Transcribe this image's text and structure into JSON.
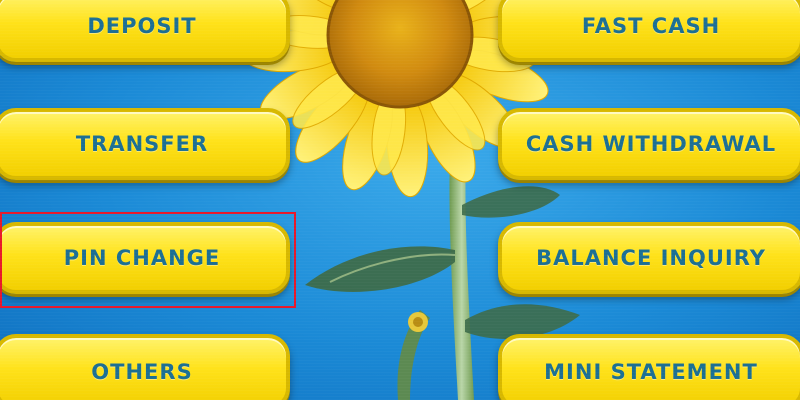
{
  "menu": {
    "deposit": "DEPOSIT",
    "transfer": "TRANSFER",
    "pin_change": "PIN CHANGE",
    "others": "OTHERS",
    "fast_cash": "FAST CASH",
    "cash_withdrawal": "CASH WITHDRAWAL",
    "balance_inquiry": "BALANCE INQUIRY",
    "mini_statement": "MINI STATEMENT"
  },
  "background_image": "sunflower-photo",
  "colors": {
    "background": "#1b8ad6",
    "button_fill": "#ffe21a",
    "button_text": "#1c6f93",
    "highlight_outline": "#e8182a"
  }
}
